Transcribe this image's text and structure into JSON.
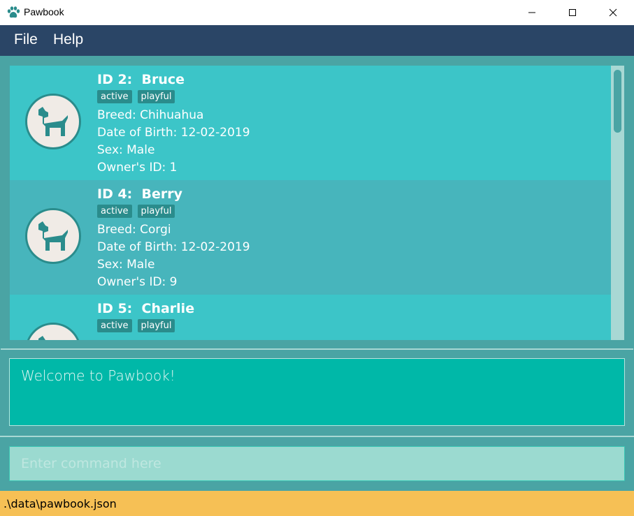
{
  "window": {
    "title": "Pawbook"
  },
  "menu": {
    "file": "File",
    "help": "Help"
  },
  "pets": [
    {
      "name": "ID 2:  Bruce",
      "tags": [
        "active",
        "playful"
      ],
      "breed": "Breed: Chihuahua",
      "dob": "Date of Birth: 12-02-2019",
      "sex": "Sex: Male",
      "owner": "Owner's ID: 1"
    },
    {
      "name": "ID 4:  Berry",
      "tags": [
        "active",
        "playful"
      ],
      "breed": "Breed: Corgi",
      "dob": "Date of Birth: 12-02-2019",
      "sex": "Sex: Male",
      "owner": "Owner's ID: 9"
    },
    {
      "name": "ID 5:  Charlie",
      "tags": [
        "active",
        "playful"
      ],
      "breed": "",
      "dob": "",
      "sex": "",
      "owner": ""
    }
  ],
  "result": {
    "message": "Welcome to Pawbook!"
  },
  "command": {
    "placeholder": "Enter command here",
    "value": ""
  },
  "status": {
    "path": ".\\data\\pawbook.json"
  },
  "colors": {
    "menubar": "#2a4566",
    "panel": "#4aa4a4",
    "card_odd": "#3cc5c8",
    "card_even": "#47b5bc",
    "result": "#00b8a8",
    "statusbar": "#f6c055",
    "accent": "#2a8c8c"
  },
  "icons": {
    "app": "paw-icon",
    "avatar": "dog-icon"
  }
}
